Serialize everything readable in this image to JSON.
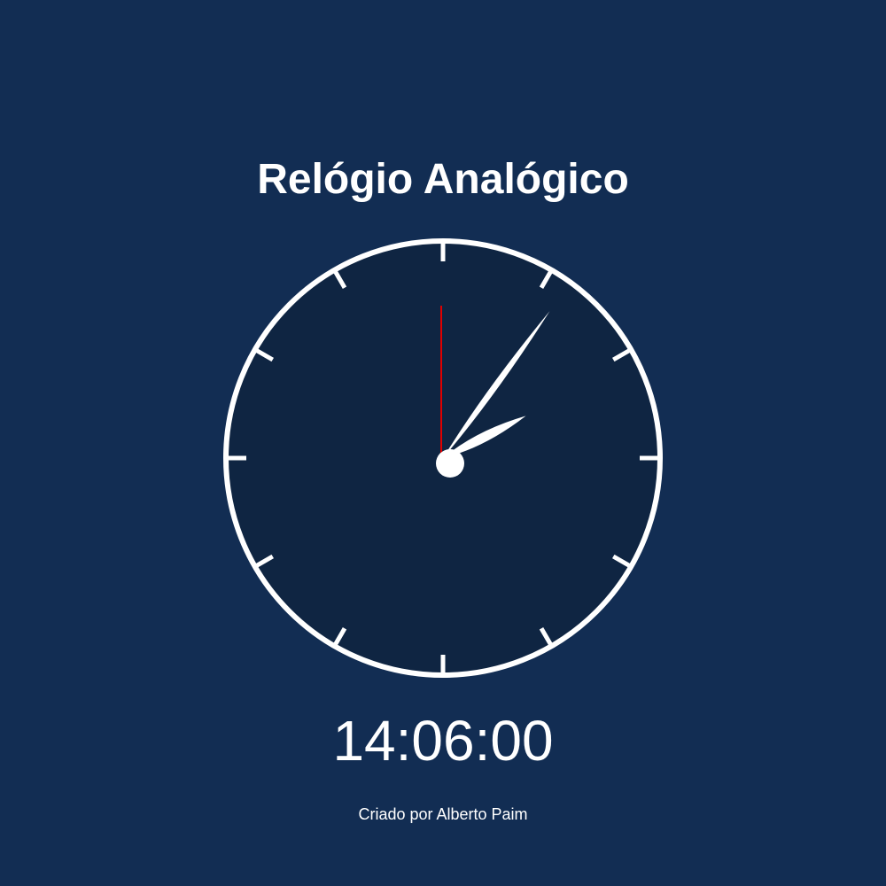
{
  "page": {
    "title": "Relógio Analógico",
    "credit": "Criado por Alberto Paim"
  },
  "clock": {
    "digital_time": "14:06:00",
    "hours": 14,
    "minutes": 6,
    "seconds": 0,
    "tick_count": 12
  },
  "colors": {
    "background": "#122d53",
    "clock_face": "#0f2542",
    "rim": "#ffffff",
    "hand": "#ffffff",
    "second_hand": "#e00000",
    "text": "#ffffff"
  }
}
